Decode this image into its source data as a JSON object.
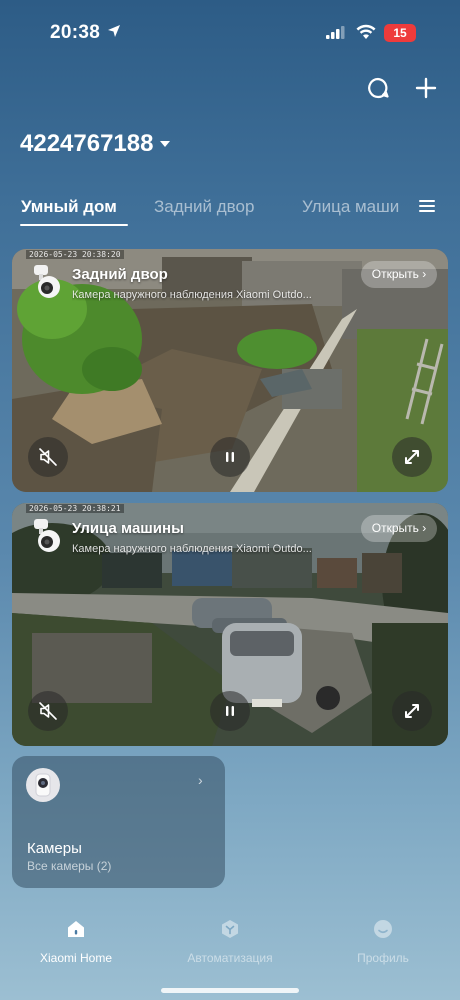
{
  "status_bar": {
    "time": "20:38",
    "battery": "15"
  },
  "header": {
    "home_name": "4224767188"
  },
  "tabs": [
    {
      "label": "Умный дом",
      "active": true
    },
    {
      "label": "Задний двор",
      "active": false
    },
    {
      "label": "Улица маши",
      "active": false
    }
  ],
  "cameras": [
    {
      "name": "Задний двор",
      "description": "Камера наружного наблюдения Xiaomi Outdo...",
      "timestamp": "2026-05-23 20:38:20",
      "open_label": "Открыть"
    },
    {
      "name": "Улица машины",
      "description": "Камера наружного наблюдения Xiaomi Outdo...",
      "timestamp": "2026-05-23 20:38:21",
      "open_label": "Открыть"
    }
  ],
  "tile": {
    "title": "Камеры",
    "subtitle": "Все камеры (2)"
  },
  "bottom_nav": [
    {
      "label": "Xiaomi Home",
      "icon": "home-icon",
      "active": true
    },
    {
      "label": "Автоматизация",
      "icon": "automation-icon",
      "active": false
    },
    {
      "label": "Профиль",
      "icon": "profile-icon",
      "active": false
    }
  ],
  "icons": {
    "location": "location-arrow-icon",
    "chat": "chat-bubble-icon",
    "add": "plus-icon",
    "menu": "menu-icon",
    "mute": "speaker-muted-icon",
    "pause": "pause-icon",
    "fullscreen": "fullscreen-icon"
  },
  "colors": {
    "battery_low": "#ee3b3b",
    "background_top": "#2d5c86",
    "background_bottom": "#9cbfd2"
  }
}
